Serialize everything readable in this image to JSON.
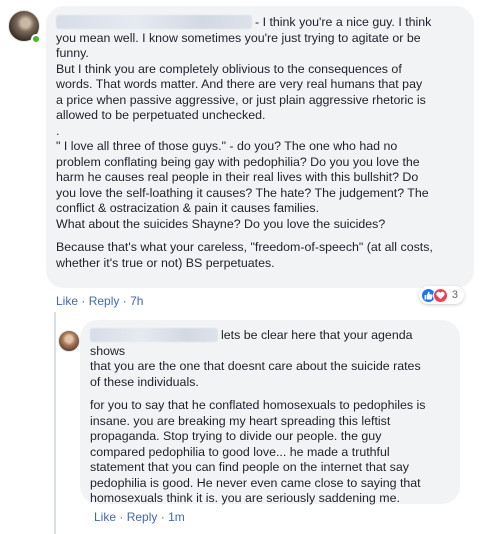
{
  "comment": {
    "text_line1_after_name": "- I think you're a nice guy. I think",
    "paragraph1_rest": "you mean well. I know sometimes you're just trying to agitate or be\nfunny.\nBut I think you are completely oblivious to the consequences of\nwords. That words matter. And there are very real humans that pay\na price when passive aggressive, or just plain aggressive rhetoric is\nallowed to be perpetuated unchecked.\n.\n\" I love all three of those guys.\" - do you? The one who had no\nproblem conflating being gay with pedophilia? Do you you love the\nharm he causes real people in their real lives with this bullshit? Do\nyou love the self-loathing it causes? The hate? The judgement? The\nconflict & ostracization & pain it causes families.\nWhat about the suicides Shayne? Do you love the suicides?",
    "paragraph2": "Because that's what your careless, \"freedom-of-speech\" (at all costs,\nwhether it's true or not) BS perpetuates.",
    "actions": {
      "like": "Like",
      "reply": "Reply",
      "separator": "·",
      "time": "7h"
    },
    "reactions": {
      "icons": [
        "like-icon",
        "love-icon"
      ],
      "count": "3",
      "colors": {
        "like": "#1877f2",
        "love": "#f33e58"
      }
    }
  },
  "reply": {
    "text_line1_after_name": "lets be clear here that your agenda shows",
    "paragraph1_rest": "that you are the one that doesnt care about the suicide rates\nof these individuals.",
    "paragraph2": "for you to say that he conflated homosexuals to pedophiles is\ninsane. you are breaking my heart spreading this leftist\npropaganda. Stop trying to divide our people. the guy\ncompared pedophilia to good love... he made a truthful\nstatement that you can find people on the internet that say\npedophilia is good. He never even came close to saying that\nhomosexuals think it is. you are seriously saddening me.",
    "actions": {
      "like": "Like",
      "reply": "Reply",
      "separator": "·",
      "time": "1m"
    }
  },
  "colors": {
    "bubble_bg": "#f2f3f5",
    "link": "#4267b2",
    "meta_text": "#606770",
    "online": "#42b72a"
  }
}
